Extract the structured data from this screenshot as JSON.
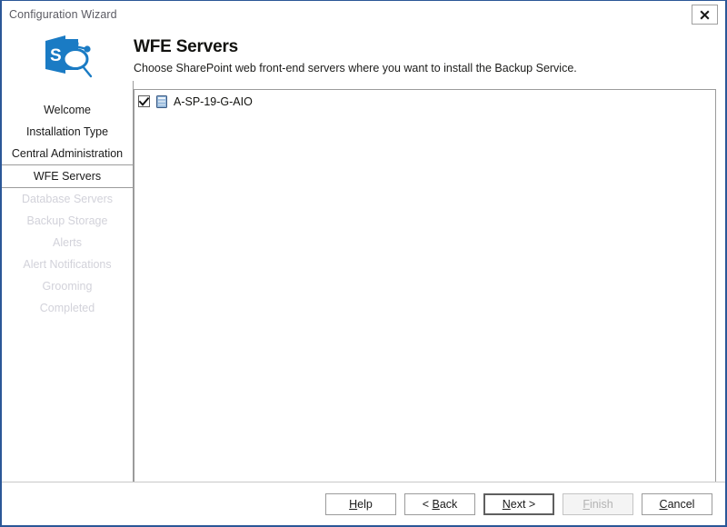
{
  "window": {
    "title": "Configuration Wizard",
    "close_icon": "close-icon",
    "border_color": "#2b5797"
  },
  "header": {
    "logo_icon": "sharepoint-logo-icon",
    "logo_color": "#1a7bc4",
    "heading": "WFE Servers",
    "subheading": "Choose SharePoint web front-end servers where you want to install the Backup Service."
  },
  "sidebar": {
    "items": [
      {
        "label": "Welcome",
        "state": "done"
      },
      {
        "label": "Installation Type",
        "state": "done"
      },
      {
        "label": "Central Administration",
        "state": "done"
      },
      {
        "label": "WFE Servers",
        "state": "current"
      },
      {
        "label": "Database Servers",
        "state": "disabled"
      },
      {
        "label": "Backup Storage",
        "state": "disabled"
      },
      {
        "label": "Alerts",
        "state": "disabled"
      },
      {
        "label": "Alert Notifications",
        "state": "disabled"
      },
      {
        "label": "Grooming",
        "state": "disabled"
      },
      {
        "label": "Completed",
        "state": "disabled"
      }
    ]
  },
  "main": {
    "servers": [
      {
        "name": "A-SP-19-G-AIO",
        "checked": true,
        "icon": "server-icon"
      }
    ]
  },
  "footer": {
    "buttons": [
      {
        "id": "help",
        "prefix": "",
        "accel": "H",
        "suffix": "elp",
        "state": "enabled"
      },
      {
        "id": "back",
        "prefix": "< ",
        "accel": "B",
        "suffix": "ack",
        "state": "enabled"
      },
      {
        "id": "next",
        "prefix": "",
        "accel": "N",
        "suffix": "ext >",
        "state": "default"
      },
      {
        "id": "finish",
        "prefix": "",
        "accel": "F",
        "suffix": "inish",
        "state": "disabled"
      },
      {
        "id": "cancel",
        "prefix": "",
        "accel": "C",
        "suffix": "ancel",
        "state": "enabled"
      }
    ]
  }
}
